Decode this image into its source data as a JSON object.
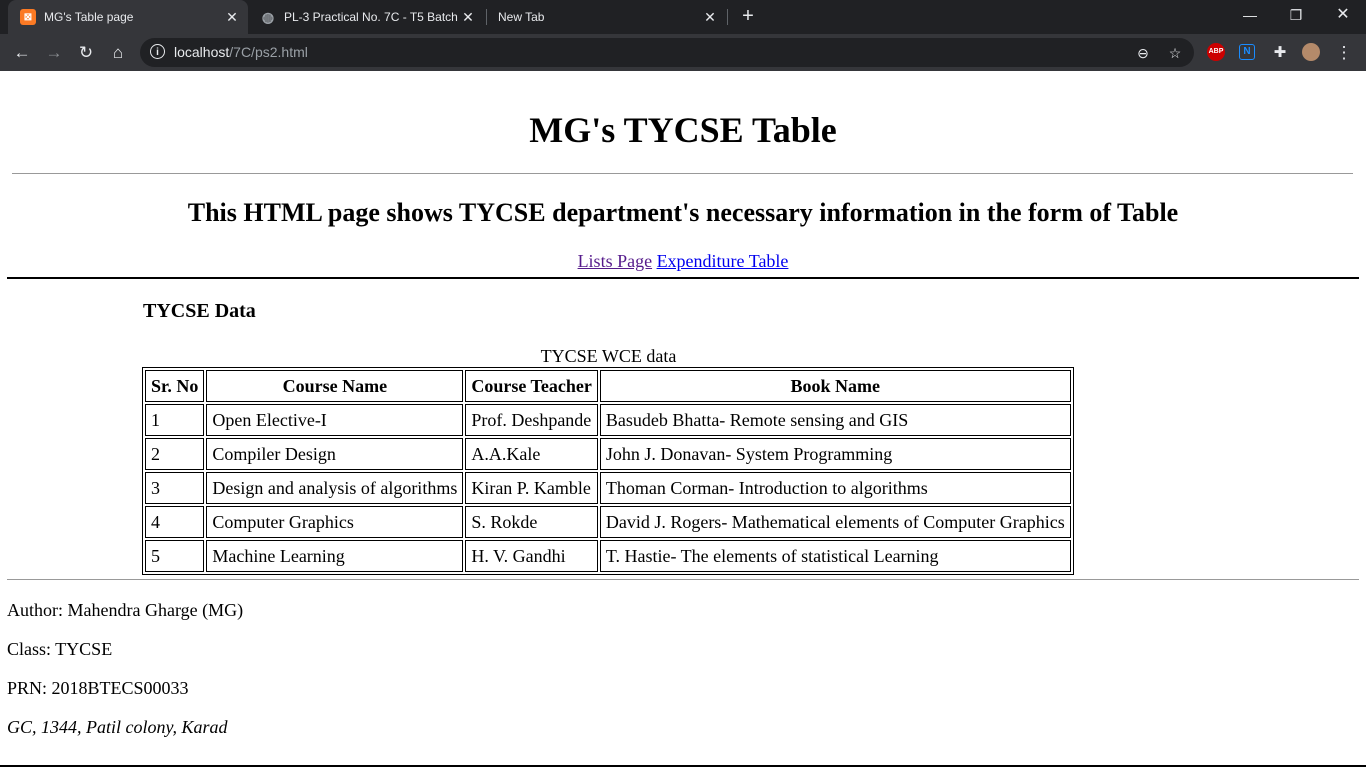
{
  "browser": {
    "tabs": [
      {
        "title": "MG's Table page",
        "active": true
      },
      {
        "title": "PL-3 Practical No. 7C - T5 Batch.p",
        "active": false
      },
      {
        "title": "New Tab",
        "active": false
      }
    ],
    "url_host": "localhost",
    "url_path": "/7C/ps2.html",
    "extensions": {
      "abp": "ABP",
      "notion": "N"
    }
  },
  "page": {
    "heading": "MG's TYCSE Table",
    "subheading": "This HTML page shows TYCSE department's necessary information in the form of Table",
    "links": {
      "lists": "Lists Page",
      "expenditure": "Expenditure Table"
    },
    "section_title": "TYCSE Data",
    "table": {
      "caption": "TYCSE WCE data",
      "headers": [
        "Sr. No",
        "Course Name",
        "Course Teacher",
        "Book Name"
      ],
      "rows": [
        [
          "1",
          "Open Elective-I",
          "Prof. Deshpande",
          "Basudeb Bhatta- Remote sensing and GIS"
        ],
        [
          "2",
          "Compiler Design",
          "A.A.Kale",
          "John J. Donavan- System Programming"
        ],
        [
          "3",
          "Design and analysis of algorithms",
          "Kiran P. Kamble",
          "Thoman Corman- Introduction to algorithms"
        ],
        [
          "4",
          "Computer Graphics",
          "S. Rokde",
          "David J. Rogers- Mathematical elements of Computer Graphics"
        ],
        [
          "5",
          "Machine Learning",
          "H. V. Gandhi",
          "T. Hastie- The elements of statistical Learning"
        ]
      ]
    },
    "author": "Author: Mahendra Gharge (MG)",
    "class": "Class: TYCSE",
    "prn": "PRN: 2018BTECS00033",
    "address": "GC, 1344, Patil colony, Karad"
  }
}
